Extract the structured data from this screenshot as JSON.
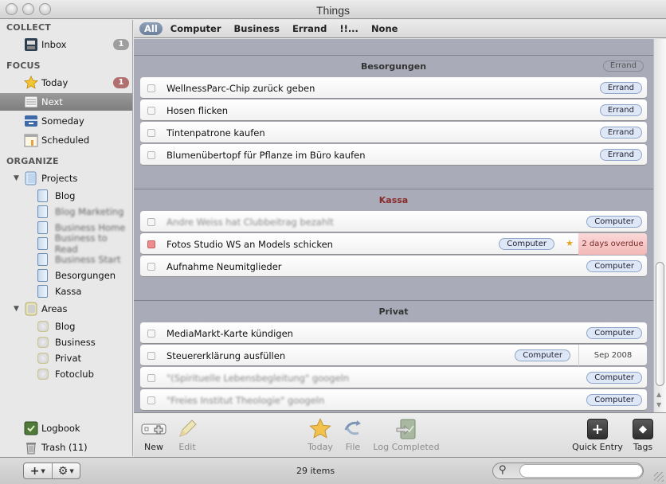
{
  "window": {
    "title": "Things"
  },
  "sidebar": {
    "sections": {
      "collect": "COLLECT",
      "focus": "FOCUS",
      "organize": "ORGANIZE"
    },
    "inbox": {
      "label": "Inbox",
      "badge": "1"
    },
    "today": {
      "label": "Today",
      "badge": "1"
    },
    "next": {
      "label": "Next"
    },
    "someday": {
      "label": "Someday"
    },
    "scheduled": {
      "label": "Scheduled"
    },
    "projects": {
      "label": "Projects",
      "items": [
        {
          "label": "Blog",
          "blurred": false
        },
        {
          "label": "Blog Marketing",
          "blurred": true
        },
        {
          "label": "Business Home",
          "blurred": true
        },
        {
          "label": "Business to Read",
          "blurred": true
        },
        {
          "label": "Business Start",
          "blurred": true
        },
        {
          "label": "Besorgungen",
          "blurred": false
        },
        {
          "label": "Kassa",
          "blurred": false
        }
      ]
    },
    "areas": {
      "label": "Areas",
      "items": [
        {
          "label": "Blog"
        },
        {
          "label": "Business"
        },
        {
          "label": "Privat"
        },
        {
          "label": "Fotoclub"
        }
      ]
    },
    "logbook": {
      "label": "Logbook"
    },
    "trash": {
      "label": "Trash (11)"
    }
  },
  "filters": {
    "tags": [
      "All",
      "Computer",
      "Business",
      "Errand",
      "!!...",
      "None"
    ],
    "active": "All"
  },
  "groups": [
    {
      "title": "Besorgungen",
      "tag": "Errand",
      "highlight": false,
      "items": [
        {
          "text": "WellnessParc-Chip zurück geben",
          "tag": "Errand"
        },
        {
          "text": "Hosen flicken",
          "tag": "Errand"
        },
        {
          "text": "Tintenpatrone kaufen",
          "tag": "Errand"
        },
        {
          "text": "Blumenübertopf für Pflanze im Büro kaufen",
          "tag": "Errand"
        }
      ]
    },
    {
      "title": "Kassa",
      "tag": "",
      "highlight": true,
      "items": [
        {
          "text": "Andre Weiss hat Clubbeitrag bezahlt",
          "tag": "Computer",
          "blurred": true
        },
        {
          "text": "Fotos Studio WS an Models schicken",
          "tag": "Computer",
          "starred": true,
          "due": "2 days overdue",
          "overdue": true
        },
        {
          "text": "Aufnahme Neumitglieder",
          "tag": "Computer"
        }
      ]
    },
    {
      "title": "Privat",
      "tag": "",
      "highlight": false,
      "items": [
        {
          "text": "MediaMarkt-Karte kündigen",
          "tag": "Computer"
        },
        {
          "text": "Steuererklärung ausfüllen",
          "tag": "Computer",
          "due": "Sep 2008"
        },
        {
          "text": "\"(Spirituelle Lebensbegleitung\" googeln",
          "tag": "Computer",
          "blurred": true
        },
        {
          "text": "\"Freies Institut Theologie\" googeln",
          "tag": "Computer",
          "blurred": true
        }
      ]
    }
  ],
  "toolbar": {
    "new": "New",
    "edit": "Edit",
    "today": "Today",
    "file": "File",
    "log_completed": "Log Completed",
    "quick_entry": "Quick Entry",
    "tags": "Tags"
  },
  "footer": {
    "items_count": "29 items",
    "search_value": ""
  },
  "colors": {
    "list_background": "#a9acb8",
    "tag_fill": "#dde7f6",
    "overdue_fill": "#f3b8b8",
    "selected_sidebar": "#8a8a8a"
  }
}
